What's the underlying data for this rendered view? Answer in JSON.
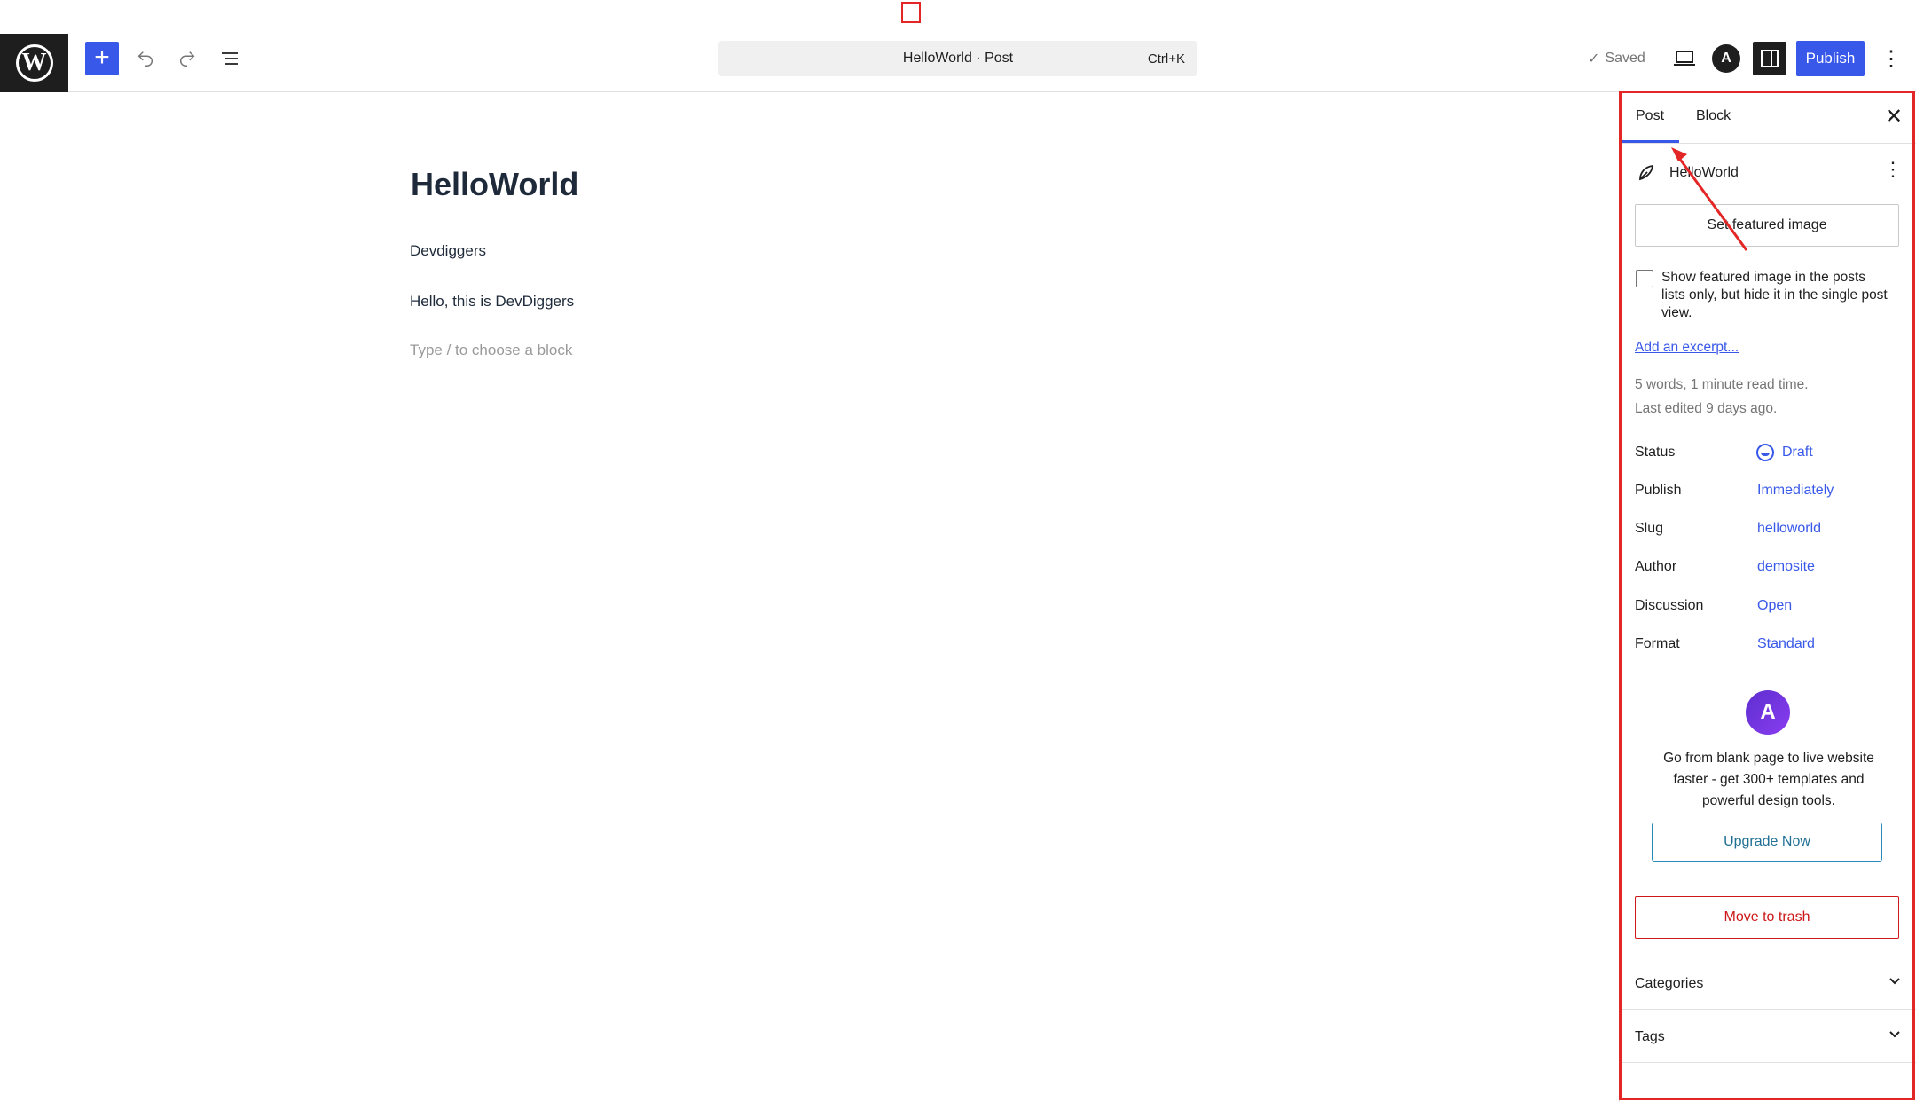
{
  "toolbar": {
    "logo_letter": "W",
    "add_symbol": "+",
    "document_title": "HelloWorld · Post",
    "shortcut": "Ctrl+K",
    "saved_label": "Saved",
    "astra_letter": "A",
    "publish_label": "Publish",
    "more_symbol": "⋮"
  },
  "editor": {
    "title": "HelloWorld",
    "paragraphs": [
      "Devdiggers",
      "Hello, this is DevDiggers"
    ],
    "placeholder": "Type / to choose a block"
  },
  "sidebar": {
    "tabs": [
      "Post",
      "Block"
    ],
    "active_tab": "Post",
    "close_symbol": "✕",
    "post_name": "HelloWorld",
    "post_more_symbol": "⋮",
    "featured_image_label": "Set featured image",
    "checkbox_label": "Show featured image in the posts lists only, but hide it in the single post view.",
    "excerpt_link": "Add an excerpt...",
    "word_count": "5 words, 1 minute read time.",
    "last_edited": "Last edited 9 days ago.",
    "fields": {
      "status": {
        "label": "Status",
        "value": "Draft"
      },
      "publish": {
        "label": "Publish",
        "value": "Immediately"
      },
      "slug": {
        "label": "Slug",
        "value": "helloworld"
      },
      "author": {
        "label": "Author",
        "value": "demosite"
      },
      "discussion": {
        "label": "Discussion",
        "value": "Open"
      },
      "format": {
        "label": "Format",
        "value": "Standard"
      }
    },
    "promo": {
      "logo_letter": "A",
      "text": "Go from blank page to live website faster - get 300+ templates and powerful design tools.",
      "button": "Upgrade Now"
    },
    "trash_label": "Move to trash",
    "panels": {
      "categories": "Categories",
      "tags": "Tags"
    },
    "chevron_symbol": "⌄"
  },
  "colors": {
    "accent": "#3858e9",
    "annotation_red": "#e32626",
    "danger": "#cc1818",
    "dark": "#1e1e1e"
  }
}
